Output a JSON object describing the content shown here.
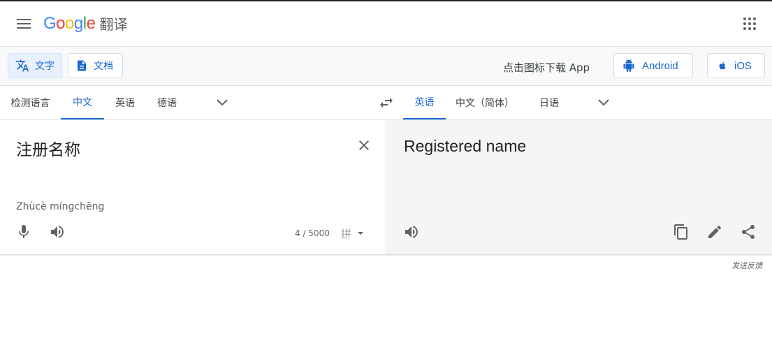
{
  "header": {
    "logo_letters": [
      "G",
      "o",
      "o",
      "g",
      "l",
      "e"
    ],
    "logo_colors": [
      "#4285F4",
      "#EA4335",
      "#FBBC05",
      "#4285F4",
      "#34A853",
      "#EA4335"
    ],
    "product_name": "翻译",
    "menu_icon": "hamburger-menu-icon",
    "apps_icon": "apps-grid-icon"
  },
  "toolbar": {
    "text_mode_label": "文字",
    "document_mode_label": "文档",
    "download_text": "点击图标下载 App",
    "android_label": "Android",
    "ios_label": "iOS"
  },
  "languages": {
    "source_tabs": [
      "检测语言",
      "中文",
      "英语",
      "德语"
    ],
    "source_active": "中文",
    "target_tabs": [
      "英语",
      "中文（简体）",
      "日语"
    ],
    "target_active": "英语"
  },
  "source": {
    "text": "注册名称",
    "pinyin": "Zhùcè míngchēng",
    "char_count": "4 / 5000",
    "ime_label": "拼"
  },
  "target": {
    "text": "Registered name"
  },
  "footer": {
    "feedback": "发送反馈"
  },
  "colors": {
    "accent": "#1967d2",
    "active_bg": "#e8f0fe",
    "icon_gray": "#5f6368"
  }
}
